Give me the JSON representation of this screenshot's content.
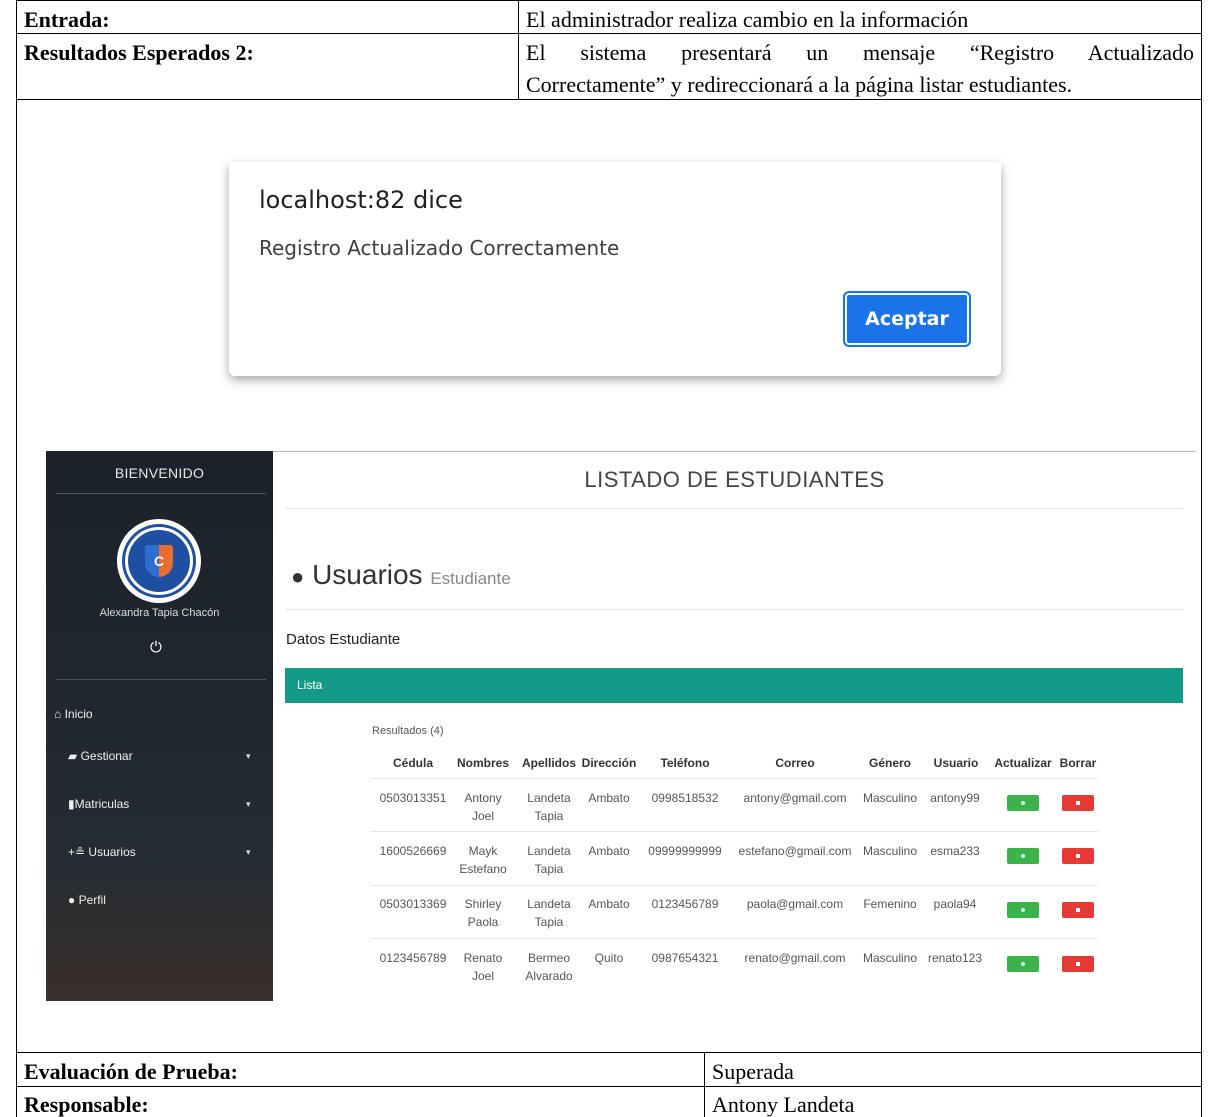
{
  "doc": {
    "entrada_label": "Entrada:",
    "entrada_value": "El administrador realiza cambio en la información",
    "resultados_label": "Resultados Esperados 2:",
    "resultados_value_1": "El sistema presentará un mensaje “Registro Actualizado",
    "resultados_value_2": "Correctamente” y redireccionará a la página listar estudiantes.",
    "evaluacion_label": "Evaluación de Prueba:",
    "evaluacion_value": "Superada",
    "responsable_label": "Responsable:",
    "responsable_value": "Antony Landeta"
  },
  "dialog": {
    "title": "localhost:82 dice",
    "message": "Registro Actualizado Correctamente",
    "button": "Aceptar"
  },
  "sidebar": {
    "welcome": "BIENVENIDO",
    "user_name": "Alexandra Tapia Chacón",
    "items": [
      {
        "label": "Inicio",
        "icon": "home-icon"
      },
      {
        "label": "Gestionar",
        "icon": "briefcase-icon"
      },
      {
        "label": "Matriculas",
        "icon": "book-icon"
      },
      {
        "label": "Usuarios",
        "icon": "users-icon"
      },
      {
        "label": "Perfil",
        "icon": "user-icon"
      }
    ]
  },
  "main": {
    "title": "LISTADO DE ESTUDIANTES",
    "section": "Usuarios",
    "section_sub": "Estudiante",
    "datos": "Datos Estudiante",
    "lista": "Lista",
    "results": "Resultados (4)"
  },
  "table": {
    "headers": [
      "Cédula",
      "Nombres",
      "Apellidos",
      "Dirección",
      "Teléfono",
      "Correo",
      "Género",
      "Usuario",
      "Actualizar",
      "Borrar"
    ],
    "rows": [
      {
        "cedula": "0503013351",
        "nombres_1": "Antony",
        "nombres_2": "Joel",
        "apellidos_1": "Landeta",
        "apellidos_2": "Tapia",
        "direccion": "Ambato",
        "telefono": "0998518532",
        "correo": "antony@gmail.com",
        "genero": "Masculino",
        "usuario": "antony99"
      },
      {
        "cedula": "1600526669",
        "nombres_1": "Mayk",
        "nombres_2": "Estefano",
        "apellidos_1": "Landeta",
        "apellidos_2": "Tapia",
        "direccion": "Ambato",
        "telefono": "09999999999",
        "correo": "estefano@gmail.com",
        "genero": "Masculino",
        "usuario": "esma233"
      },
      {
        "cedula": "0503013369",
        "nombres_1": "Shirley",
        "nombres_2": "Paola",
        "apellidos_1": "Landeta",
        "apellidos_2": "Tapia",
        "direccion": "Ambato",
        "telefono": "0123456789",
        "correo": "paola@gmail.com",
        "genero": "Femenino",
        "usuario": "paola94"
      },
      {
        "cedula": "0123456789",
        "nombres_1": "Renato",
        "nombres_2": "Joel",
        "apellidos_1": "Bermeo",
        "apellidos_2": "Alvarado",
        "direccion": "Quito",
        "telefono": "0987654321",
        "correo": "renato@gmail.com",
        "genero": "Masculino",
        "usuario": "renato123"
      }
    ]
  }
}
